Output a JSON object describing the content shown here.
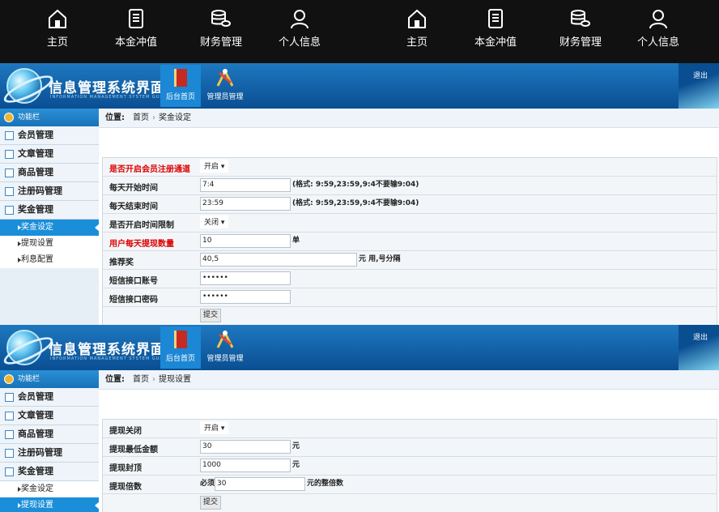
{
  "topnav": [
    {
      "label": "主页",
      "icon": "home-icon"
    },
    {
      "label": "本金冲值",
      "icon": "document-icon"
    },
    {
      "label": "财务管理",
      "icon": "coins-icon"
    },
    {
      "label": "个人信息",
      "icon": "user-icon"
    },
    {
      "label": "主页",
      "icon": "home-icon"
    },
    {
      "label": "本金冲值",
      "icon": "document-icon"
    },
    {
      "label": "财务管理",
      "icon": "coins-icon"
    },
    {
      "label": "个人信息",
      "icon": "user-icon"
    }
  ],
  "banner": {
    "title": "信息管理系统界面",
    "subtitle": "INFORMATION MANAGEMENT SYSTEM GUI",
    "tab_home": "后台首页",
    "tab_admin": "管理员管理",
    "logout": "退出"
  },
  "sidebar": {
    "header": "功能栏",
    "items": [
      "会员管理",
      "文章管理",
      "商品管理",
      "注册码管理",
      "奖金管理"
    ],
    "subitems": [
      "奖金设定",
      "提现设置",
      "利息配置"
    ]
  },
  "panel1": {
    "crumb_label": "位置:",
    "crumb_home": "首页",
    "crumb_current": "奖金设定",
    "rows": [
      {
        "label": "是否开启会员注册通道",
        "select": "开启"
      },
      {
        "label": "每天开始时间",
        "value": "7:4",
        "note": "(格式: 9:59,23:59,9:4不要输9:04)"
      },
      {
        "label": "每天结束时间",
        "value": "23:59",
        "note": "(格式: 9:59,23:59,9:4不要输9:04)"
      },
      {
        "label": "是否开启时间限制",
        "select": "关闭"
      },
      {
        "label": "用户每天提现数量",
        "value": "10",
        "note": "单"
      },
      {
        "label": "推荐奖",
        "value": "40,5",
        "note": "元 用,号分隔"
      },
      {
        "label": "短信接口账号",
        "value": "••••••"
      },
      {
        "label": "短信接口密码",
        "value": "••••••"
      }
    ],
    "submit": "提交"
  },
  "panel2": {
    "crumb_label": "位置:",
    "crumb_home": "首页",
    "crumb_current": "提现设置",
    "rows": [
      {
        "label": "提现关闭",
        "select": "开启"
      },
      {
        "label": "提现最低金额",
        "value": "30",
        "note": "元"
      },
      {
        "label": "提现封顶",
        "value": "1000",
        "note": "元"
      },
      {
        "label": "提现倍数",
        "prefix": "必须",
        "value": "30",
        "note": "元的整倍数"
      }
    ],
    "submit": "提交"
  },
  "colors": {
    "topbar": "#111111",
    "banner": "#0a4e92",
    "active": "#1a8ed9",
    "required": "#dd0000"
  }
}
